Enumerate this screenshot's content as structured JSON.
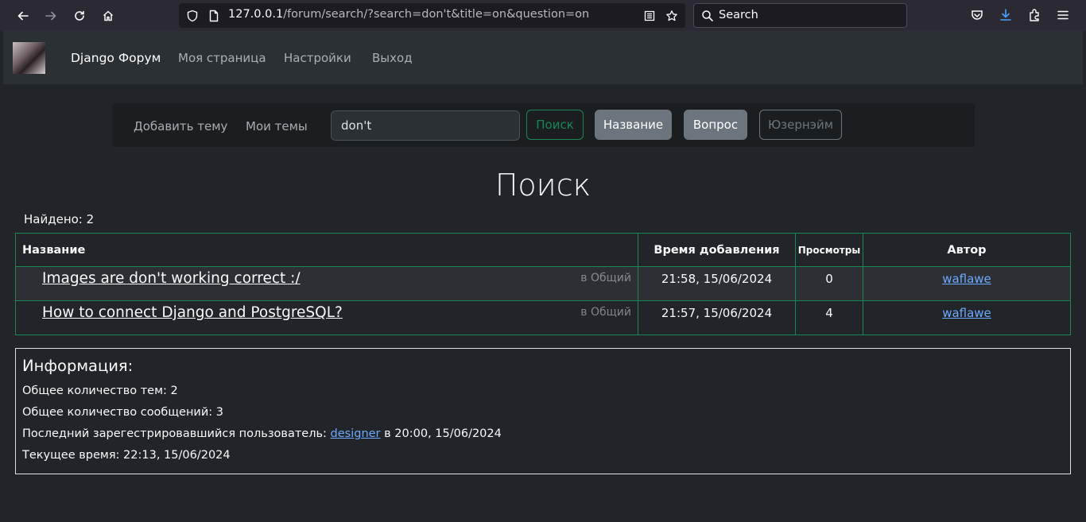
{
  "browser": {
    "url_host": "127.0.0.1",
    "url_path": "/forum/search/?search=don't&title=on&question=on",
    "search_placeholder": "Search"
  },
  "navbar": {
    "brand": "Django Форум",
    "links": [
      "Моя страница",
      "Настройки",
      "Выход"
    ]
  },
  "subnav": {
    "add_topic": "Добавить тему",
    "my_topics": "Мои темы",
    "search_value": "don't",
    "buttons": {
      "search": "Поиск",
      "title": "Название",
      "question": "Вопрос",
      "username": "Юзернэйм"
    }
  },
  "main": {
    "title": "Поиск",
    "found": "Найдено: 2",
    "table": {
      "headers": [
        "Название",
        "Время добавления",
        "Просмотры",
        "Автор"
      ],
      "rows": [
        {
          "title": "Images are don't working correct :/",
          "category": "в Общий",
          "time": "21:58, 15/06/2024",
          "views": "0",
          "author": "waflawe"
        },
        {
          "title": "How to connect Django and PostgreSQL?",
          "category": "в Общий",
          "time": "21:57, 15/06/2024",
          "views": "4",
          "author": "waflawe"
        }
      ]
    }
  },
  "info": {
    "title": "Информация:",
    "total_topics": "Общее количество тем: 2",
    "total_messages": "Общее количество сообщений: 3",
    "last_user_prefix": "Последний зарегестрировавшийся пользователь:",
    "last_user_name": "designer",
    "last_user_suffix": "в 20:00, 15/06/2024",
    "current_time": "Текущее время: 22:13, 15/06/2024"
  }
}
